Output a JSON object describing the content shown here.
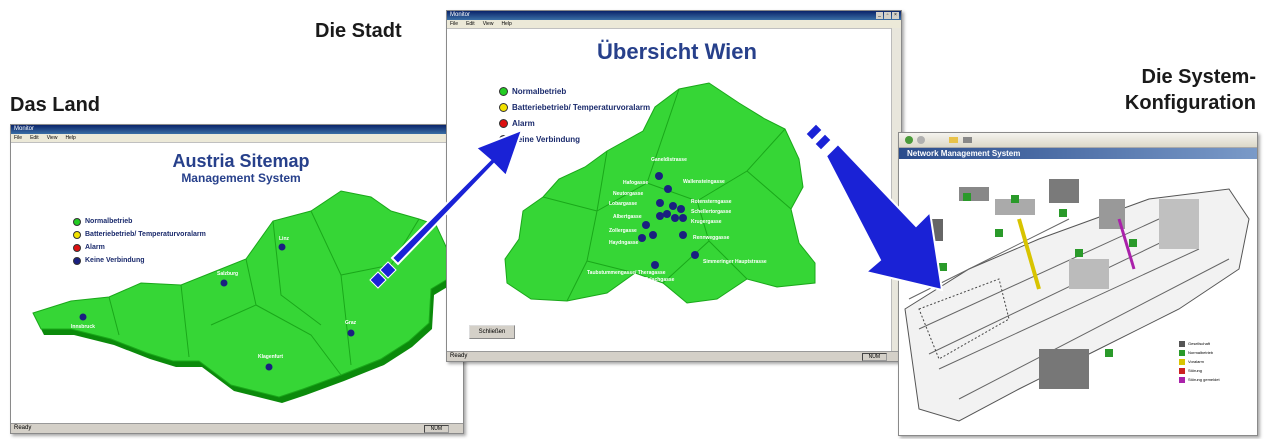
{
  "captions": {
    "land": "Das Land",
    "stadt": "Die Stadt",
    "system_line1": "Die System-",
    "system_line2": "Konfiguration"
  },
  "legend_items": [
    {
      "label": "Normalbetrieb",
      "color": "#22cc22"
    },
    {
      "label": "Batteriebetrieb/ Temperaturvoralarm",
      "color": "#f2e200"
    },
    {
      "label": "Alarm",
      "color": "#dd1111"
    },
    {
      "label": "Keine Verbindung",
      "color": "#1a2080"
    }
  ],
  "window_left": {
    "title": "Monitor",
    "menu": [
      "File",
      "Edit",
      "View",
      "Help"
    ],
    "heading": "Austria Sitemap",
    "subheading": "Management System",
    "status": "Ready",
    "num": "NUM",
    "cities": [
      "Linz",
      "Salzburg",
      "Innsbruck",
      "Graz",
      "Klagenfurt"
    ]
  },
  "window_center": {
    "title": "Monitor",
    "menu": [
      "File",
      "Edit",
      "View",
      "Help"
    ],
    "heading": "Übersicht Wien",
    "close_button": "Schließen",
    "status": "Ready",
    "num": "NUM",
    "streets": [
      "Ganeldistrasse",
      "Hafogasse",
      "Wallensteingasse",
      "Neutorgasse",
      "Lobargasse",
      "Rotensterngasse",
      "Albertgasse",
      "Schellertorgasse",
      "Krugergasse",
      "Zollergasse",
      "Haydngasse",
      "Rennweggasse",
      "Simmeringer Hauptstrasse",
      "Taubstummengasse/ Theragasse",
      "Erlachgasse"
    ]
  },
  "window_right": {
    "heading": "Network Management System",
    "legend": [
      "Gesellschaft",
      "Normalbetrieb",
      "Voralarm",
      "Störung",
      "Störung gemeldet"
    ],
    "legend_colors": [
      "#555555",
      "#2a9a2a",
      "#d8c400",
      "#cc2222",
      "#aa22aa"
    ]
  }
}
